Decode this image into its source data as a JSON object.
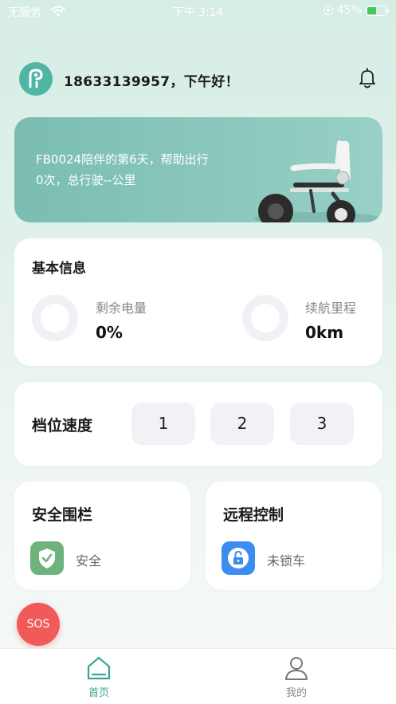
{
  "status_bar": {
    "carrier": "无服务",
    "time": "下午 3:14",
    "battery": "45%",
    "battery_level": 0.45
  },
  "header": {
    "greeting": "18633139957，下午好！",
    "avatar_icon": "app-logo-icon",
    "notification_icon": "bell-icon"
  },
  "banner": {
    "line1": "FB0024陪伴的第6天，帮助出行",
    "line2": "0次，总行驶--公里",
    "image": "wheelchair-illustration"
  },
  "basic_info": {
    "title": "基本信息",
    "battery_label": "剩余电量",
    "battery_value": "0%",
    "range_label": "续航里程",
    "range_value": "0km"
  },
  "speed": {
    "title": "档位速度",
    "gears": [
      "1",
      "2",
      "3"
    ]
  },
  "fence": {
    "title": "安全围栏",
    "status": "安全",
    "icon": "shield-check-icon"
  },
  "remote": {
    "title": "远程控制",
    "status": "未锁车",
    "icon": "unlock-icon"
  },
  "sos": {
    "label": "SOS"
  },
  "tabs": [
    {
      "label": "首页",
      "icon": "home-icon",
      "active": true
    },
    {
      "label": "我的",
      "icon": "user-icon",
      "active": false
    }
  ],
  "colors": {
    "accent": "#3aa593",
    "banner": "#84c3b8",
    "fence_icon_bg": "#6eb37d",
    "lock_icon_bg": "#3b8df1",
    "sos": "#f05a59"
  }
}
